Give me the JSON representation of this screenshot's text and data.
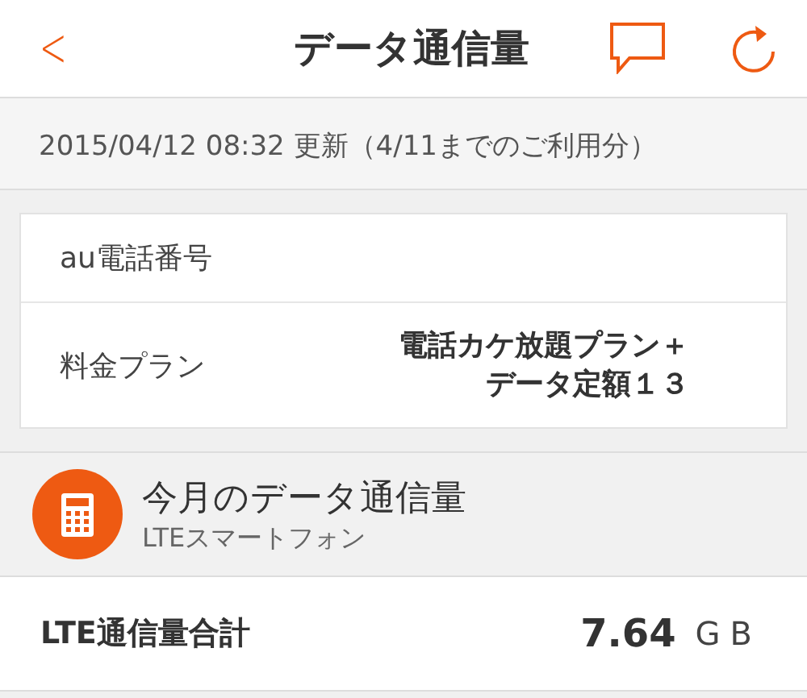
{
  "header": {
    "back": "<",
    "title": "データ通信量"
  },
  "update_note": "2015/04/12 08:32 更新（4/11までのご利用分）",
  "contract": [
    {
      "label": "au電話番号"
    },
    {
      "label": "料金プラン",
      "value_lines": [
        "電話カケ放題プラン＋",
        "データ定額１３"
      ]
    }
  ],
  "usage": {
    "title": "今月のデータ通信量",
    "subtitle": "LTEスマートフォン",
    "total_label": "LTE通信量合計",
    "total_value": "7.64",
    "total_unit": "GB"
  }
}
